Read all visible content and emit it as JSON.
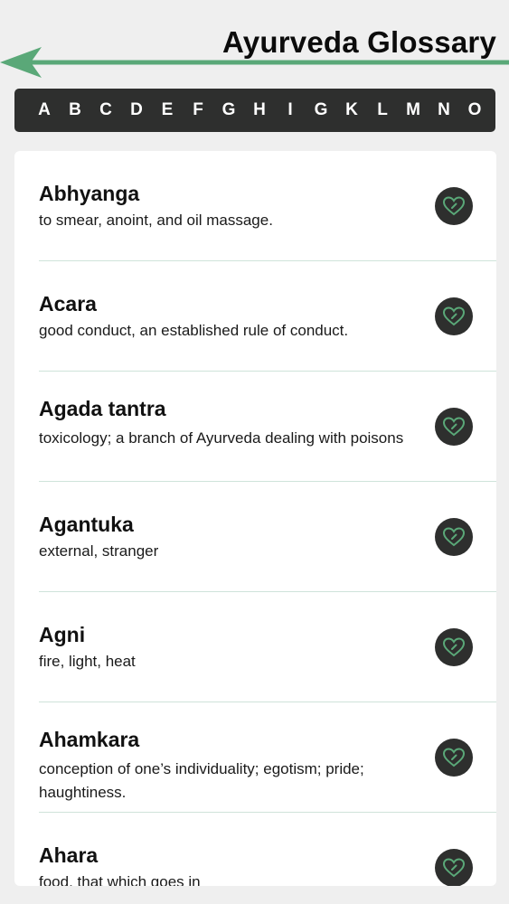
{
  "header": {
    "title": "Ayurveda Glossary"
  },
  "alphabet": [
    "A",
    "B",
    "C",
    "D",
    "E",
    "F",
    "G",
    "H",
    "I",
    "G",
    "K",
    "L",
    "M",
    "N",
    "O"
  ],
  "entries": [
    {
      "term": "Abhyanga",
      "definition": "to smear, anoint, and oil massage."
    },
    {
      "term": "Acara",
      "definition": " good conduct, an established rule of conduct."
    },
    {
      "term": "Agada tantra",
      "definition": "toxicology; a branch of Ayurveda dealing with poisons"
    },
    {
      "term": "Agantuka",
      "definition": "external, stranger"
    },
    {
      "term": "Agni",
      "definition": "fire, light, heat"
    },
    {
      "term": "Ahamkara",
      "definition": "conception of one’s individuality; egotism; pride; haughtiness."
    },
    {
      "term": "Ahara",
      "definition": "food, that which goes in"
    }
  ],
  "icons": {
    "back": "arrow-left-icon",
    "favorite": "heart-icon"
  },
  "colors": {
    "accent": "#5aa878",
    "dark": "#2e2f2e",
    "background": "#efefef"
  }
}
